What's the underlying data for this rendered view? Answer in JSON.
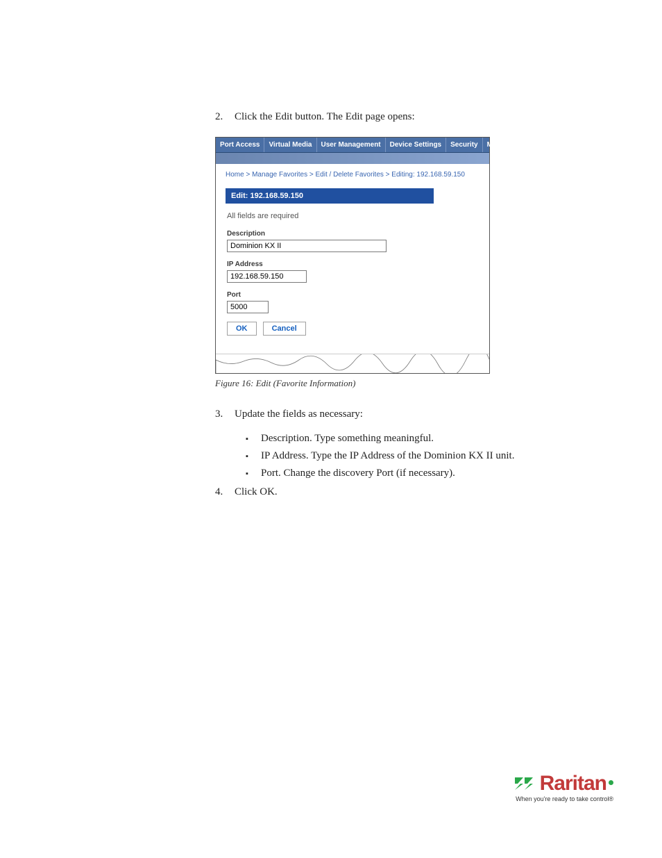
{
  "steps": {
    "s2_num": "2.",
    "s2_text": "Click the Edit button. The Edit page opens:",
    "s3_num": "3.",
    "s3_text": "Update the fields as necessary:",
    "s4_num": "4.",
    "s4_text": "Click OK."
  },
  "bullets": {
    "b1": "Description. Type something meaningful.",
    "b2": "IP Address. Type the IP Address of the Dominion KX II unit.",
    "b3": "Port. Change the discovery Port (if necessary)."
  },
  "caption": "Figure 16: Edit (Favorite Information)",
  "screenshot": {
    "tabs": {
      "port_access": "Port Access",
      "virtual_media": "Virtual Media",
      "user_management": "User Management",
      "device_settings": "Device Settings",
      "security": "Security",
      "maint": "Maint"
    },
    "breadcrumb": "Home > Manage Favorites > Edit / Delete Favorites > Editing: 192.168.59.150",
    "panel_title": "Edit: 192.168.59.150",
    "required_note": "All fields are required",
    "labels": {
      "description": "Description",
      "ip": "IP Address",
      "port": "Port"
    },
    "values": {
      "description": "Dominion KX II",
      "ip": "192.168.59.150",
      "port": "5000"
    },
    "buttons": {
      "ok": "OK",
      "cancel": "Cancel"
    }
  },
  "footer": {
    "brand": "Raritan",
    "tagline": "When you're ready to take control®"
  }
}
